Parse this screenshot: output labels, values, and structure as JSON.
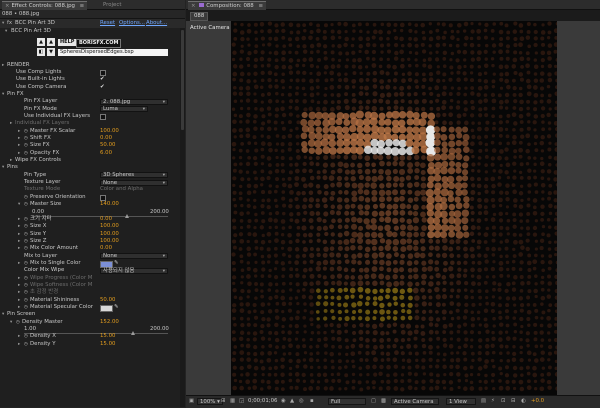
{
  "tabs_left": {
    "effect_controls": "Effect Controls: 088.jpg",
    "menu": "≡",
    "project": "Project"
  },
  "tabs_right": {
    "composition": "Composition: 088",
    "menu": "≡",
    "comp_button": "088"
  },
  "subheader": "088 • 088.jpg",
  "effect": {
    "name": "BCC Pin Art 3D",
    "reset": "Reset",
    "options": "Options...",
    "about": "About...",
    "sub_name": "BCC Pin Art 3D",
    "help": "HELP",
    "brand": "BORISFX.COM",
    "preset": "SpheresDispersedEdges.bsp"
  },
  "active_camera_label": "Active Camera",
  "rows": [
    {
      "label": "RENDER",
      "indent": 4,
      "type": "group"
    },
    {
      "label": "Use Comp Lights",
      "indent": 12,
      "type": "checkbox",
      "checked": false
    },
    {
      "label": "Use Built-in Lights",
      "indent": 12,
      "type": "checkbox",
      "checked": true
    },
    {
      "label": "Use Comp Camera",
      "indent": 12,
      "type": "checkbox",
      "checked": true
    },
    {
      "label": "Pin FX",
      "indent": 4,
      "type": "group",
      "open": true
    },
    {
      "label": "Pin FX Layer",
      "indent": 20,
      "type": "dropdown",
      "value": "2. 088.jpg"
    },
    {
      "label": "Pin FX Mode",
      "indent": 20,
      "type": "dropdown",
      "value": "Luma",
      "short": true
    },
    {
      "label": "Use Individual FX Layers",
      "indent": 20,
      "type": "checkbox",
      "checked": false
    },
    {
      "label": "Individual FX Layers",
      "indent": 12,
      "type": "group",
      "dim": true
    },
    {
      "label": "Master FX Scalar",
      "indent": 20,
      "type": "value",
      "value": "100.00",
      "sw": true
    },
    {
      "label": "Shift FX",
      "indent": 20,
      "type": "value",
      "value": "0.00",
      "sw": true
    },
    {
      "label": "Size FX",
      "indent": 20,
      "type": "value",
      "value": "50.00",
      "sw": true
    },
    {
      "label": "Opacity FX",
      "indent": 20,
      "type": "value",
      "value": "6.00",
      "sw": true
    },
    {
      "label": "Wipe FX Controls",
      "indent": 12,
      "type": "group"
    },
    {
      "label": "Pins",
      "indent": 4,
      "type": "group",
      "open": true
    },
    {
      "label": "Pin Type",
      "indent": 20,
      "type": "dropdown",
      "value": "3D Spheres"
    },
    {
      "label": "Texture Layer",
      "indent": 20,
      "type": "dropdown",
      "value": "None"
    },
    {
      "label": "Texture Mode",
      "indent": 20,
      "type": "text",
      "value": "Color and Alpha",
      "dim": true
    },
    {
      "label": "Preserve Orientation",
      "indent": 20,
      "type": "checkbox",
      "checked": false,
      "sw": true
    },
    {
      "label": "Master Size",
      "indent": 20,
      "type": "value",
      "value": "140.00",
      "sw": true,
      "open": true
    },
    {
      "label": "",
      "indent": 20,
      "type": "slider",
      "min": "0.00",
      "max": "200.00",
      "pos": 0.7
    },
    {
      "label": "크기 지터",
      "indent": 20,
      "type": "value",
      "value": "0.00",
      "sw": true
    },
    {
      "label": "Size X",
      "indent": 20,
      "type": "value",
      "value": "100.00",
      "sw": true
    },
    {
      "label": "Size Y",
      "indent": 20,
      "type": "value",
      "value": "100.00",
      "sw": true
    },
    {
      "label": "Size Z",
      "indent": 20,
      "type": "value",
      "value": "100.00",
      "sw": true
    },
    {
      "label": "Mix Color Amount",
      "indent": 20,
      "type": "value",
      "value": "0.00",
      "sw": true
    },
    {
      "label": "Mix to Layer",
      "indent": 20,
      "type": "dropdown",
      "value": "None"
    },
    {
      "label": "Mix to Single Color",
      "indent": 20,
      "type": "color",
      "color": "#7c8fd6",
      "sw": true
    },
    {
      "label": "Color Mix Wipe",
      "indent": 20,
      "type": "dropdown",
      "value": "사용되지 않음"
    },
    {
      "label": "Wipe Progress (Color M",
      "indent": 20,
      "type": "text",
      "value": "",
      "dim": true,
      "sw": true
    },
    {
      "label": "Wipe Softness (Color M",
      "indent": 20,
      "type": "text",
      "value": "",
      "dim": true,
      "sw": true
    },
    {
      "label": "초 감정 반경",
      "indent": 20,
      "type": "text",
      "value": "",
      "dim": true,
      "sw": true
    },
    {
      "label": "Material Shininess",
      "indent": 20,
      "type": "value",
      "value": "50.00",
      "sw": true
    },
    {
      "label": "Material Specular Color",
      "indent": 20,
      "type": "color",
      "color": "#d8d8d8",
      "sw": true
    },
    {
      "label": "Pin Screen",
      "indent": 4,
      "type": "group",
      "open": true
    },
    {
      "label": "Density Master",
      "indent": 12,
      "type": "value",
      "value": "152.00",
      "sw": true,
      "open": true
    },
    {
      "label": "",
      "indent": 12,
      "type": "slider",
      "min": "1.00",
      "max": "200.00",
      "pos": 0.76
    },
    {
      "label": "Density X",
      "indent": 20,
      "type": "value",
      "value": "15.00",
      "sw": true
    },
    {
      "label": "Density Y",
      "indent": 20,
      "type": "value",
      "value": "15.00",
      "sw": true
    }
  ],
  "bottom_bar": {
    "zoom": "100%",
    "timecode": "0;00;01;06",
    "resolution": "Full",
    "camera": "Active Camera",
    "views": "1 View",
    "exposure": "+0.0"
  },
  "colors": {
    "value_orange": "#e39d1f",
    "link_blue": "#6fa7ff",
    "panel_bg": "#1f1f1f"
  }
}
